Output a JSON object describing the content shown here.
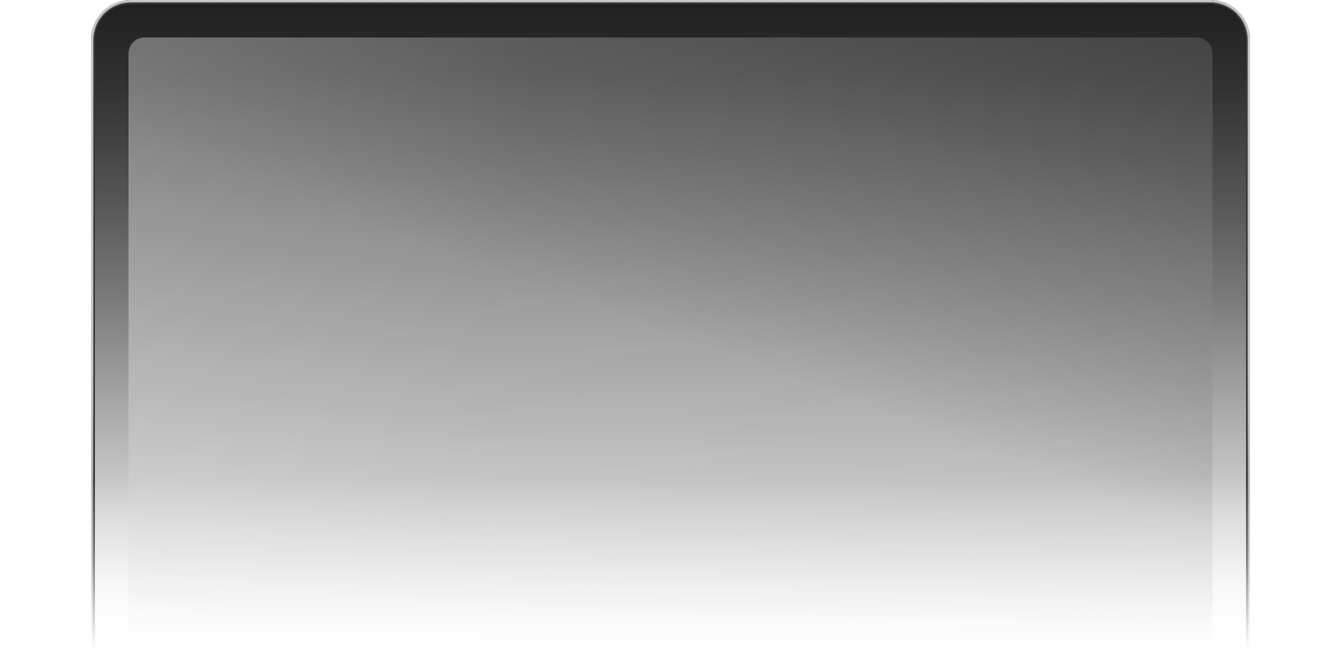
{
  "device": {
    "type": "laptop-frame",
    "screen_content": ""
  },
  "colors": {
    "bezel_top": "#1f1f1f",
    "bezel_bottom": "#ffffff",
    "screen_top": "#6a6a6a",
    "screen_bottom": "#ffffff",
    "background": "#ffffff"
  }
}
